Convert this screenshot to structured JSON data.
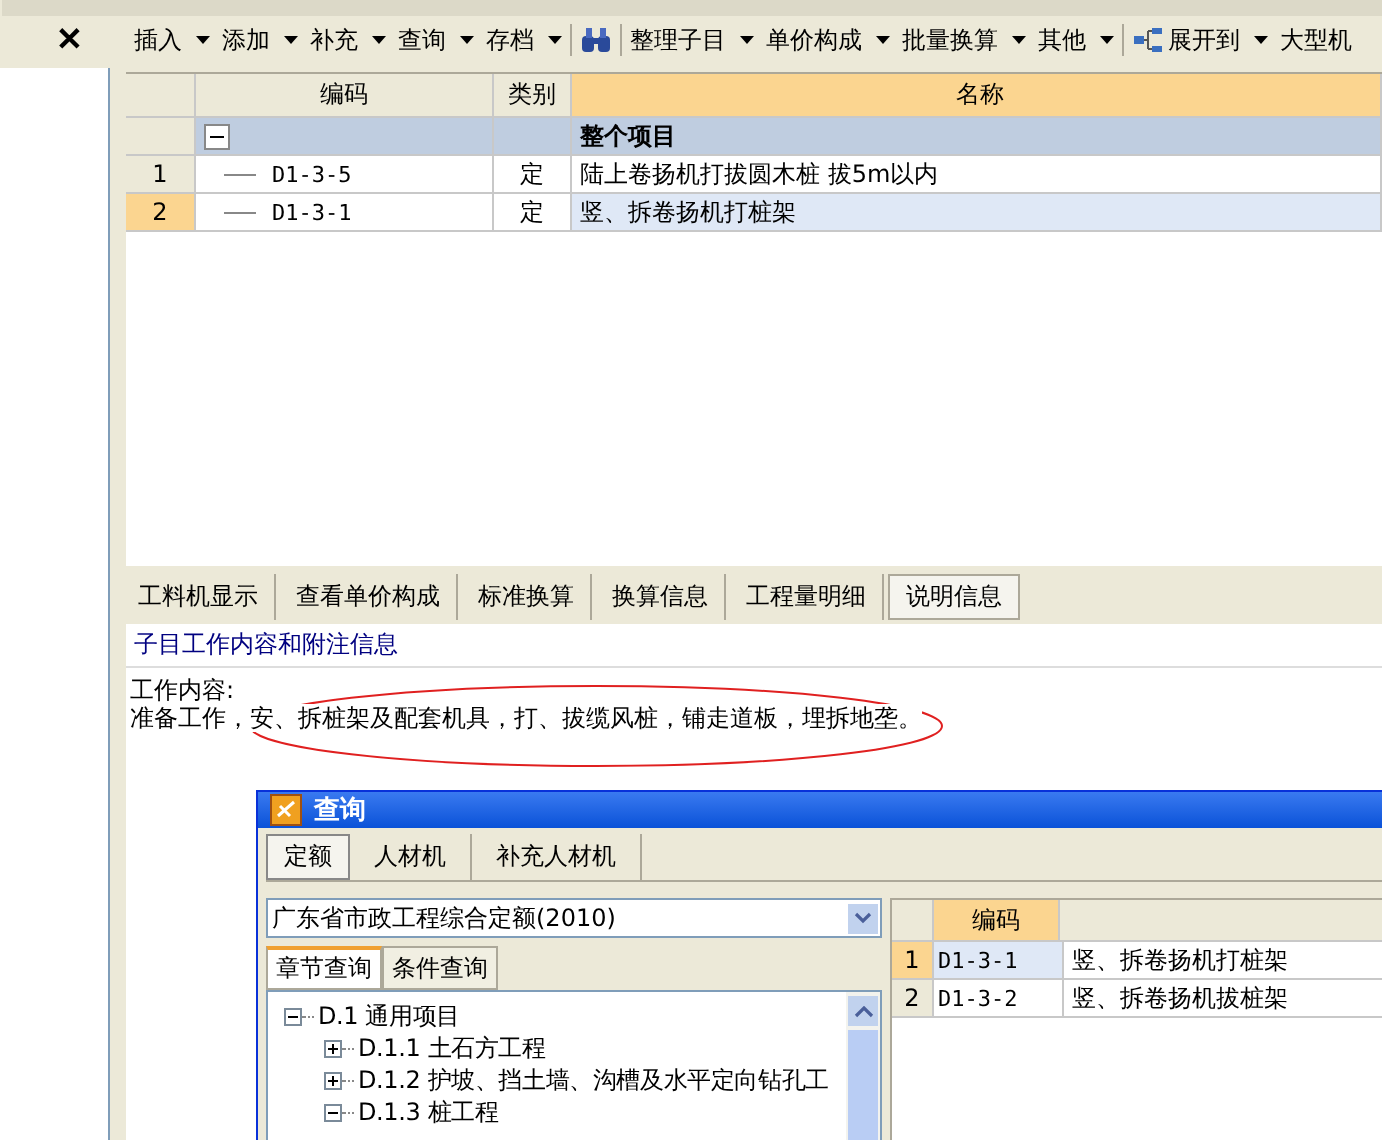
{
  "toolbar": {
    "close": "✕",
    "items": [
      {
        "label": "插入",
        "dropdown": true,
        "kind": "text"
      },
      {
        "label": "添加",
        "dropdown": true,
        "kind": "text"
      },
      {
        "label": "补充",
        "dropdown": true,
        "kind": "text"
      },
      {
        "label": "查询",
        "dropdown": true,
        "kind": "text"
      },
      {
        "label": "存档",
        "dropdown": true,
        "kind": "text"
      },
      {
        "dropdown": false,
        "kind": "binoculars"
      },
      {
        "label": "整理子目",
        "dropdown": true,
        "kind": "text"
      },
      {
        "label": "单价构成",
        "dropdown": true,
        "kind": "text"
      },
      {
        "label": "批量换算",
        "dropdown": true,
        "kind": "text"
      },
      {
        "label": "其他",
        "dropdown": true,
        "kind": "text"
      },
      {
        "label": "展开到",
        "dropdown": true,
        "kind": "tree"
      },
      {
        "label": "大型机",
        "dropdown": false,
        "kind": "text"
      }
    ]
  },
  "grid": {
    "columns": [
      "编码",
      "类别",
      "名称"
    ],
    "group": {
      "label": "整个项目",
      "expanded": true
    },
    "rows": [
      {
        "index": "1",
        "code": "D1-3-5",
        "type": "定",
        "name": "陆上卷扬机打拔圆木桩 拔5m以内",
        "selected": false
      },
      {
        "index": "2",
        "code": "D1-3-1",
        "type": "定",
        "name": "竖、拆卷扬机打桩架",
        "selected": true
      }
    ]
  },
  "detail_tabs": [
    {
      "label": "工料机显示",
      "selected": false
    },
    {
      "label": "查看单价构成",
      "selected": false
    },
    {
      "label": "标准换算",
      "selected": false
    },
    {
      "label": "换算信息",
      "selected": false
    },
    {
      "label": "工程量明细",
      "selected": false
    },
    {
      "label": "说明信息",
      "selected": true
    }
  ],
  "info": {
    "heading": "子目工作内容和附注信息",
    "lines": [
      "工作内容:",
      "准备工作，安、拆桩架及配套机具，打、拔缆风桩，铺走道板，埋拆地垄。"
    ]
  },
  "dialog": {
    "title": "查询",
    "tabs": [
      {
        "label": "定额",
        "selected": true
      },
      {
        "label": "人材机",
        "selected": false
      },
      {
        "label": "补充人材机",
        "selected": false
      }
    ],
    "library": "广东省市政工程综合定额(2010)",
    "search_tabs": [
      {
        "label": "章节查询",
        "selected": true
      },
      {
        "label": "条件查询",
        "selected": false
      }
    ],
    "tree": [
      {
        "label": "D.1 通用项目",
        "expanded": true,
        "children": [
          {
            "label": "D.1.1 土石方工程",
            "expanded": false
          },
          {
            "label": "D.1.2 护坡、挡土墙、沟槽及水平定向钻孔工",
            "expanded": false
          },
          {
            "label": "D.1.3 桩工程",
            "expanded": true
          }
        ]
      }
    ],
    "results": {
      "columns": [
        "编码"
      ],
      "rows": [
        {
          "index": "1",
          "code": "D1-3-1",
          "name": "竖、拆卷扬机打桩架",
          "selected": true
        },
        {
          "index": "2",
          "code": "D1-3-2",
          "name": "竖、拆卷扬机拔桩架",
          "selected": false
        }
      ]
    }
  }
}
